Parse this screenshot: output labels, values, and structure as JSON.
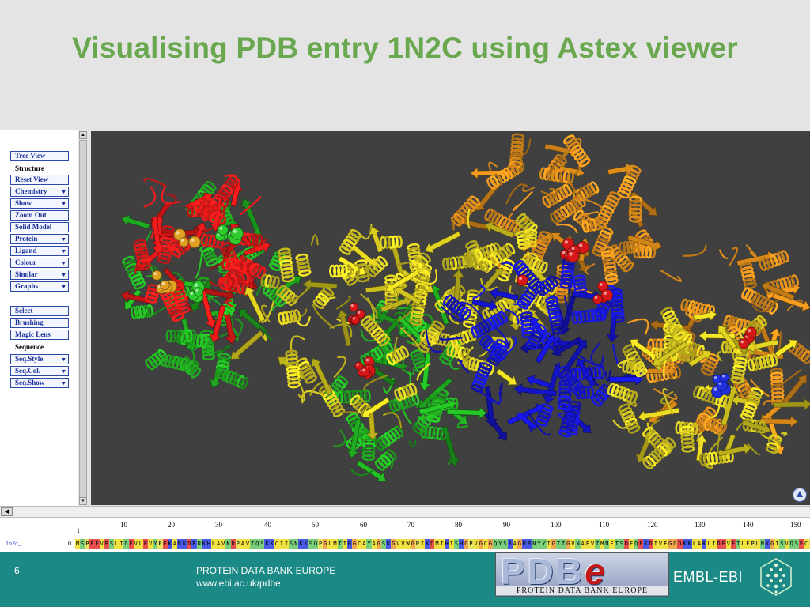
{
  "slide": {
    "title": "Visualising PDB entry 1N2C using Astex viewer"
  },
  "panel": {
    "items": [
      {
        "label": "Tree View",
        "type": "button",
        "dropdown": false
      },
      {
        "label": "Structure",
        "type": "label"
      },
      {
        "label": "Reset View",
        "type": "button",
        "dropdown": false
      },
      {
        "label": "Chemistry",
        "type": "button",
        "dropdown": true
      },
      {
        "label": "Show",
        "type": "button",
        "dropdown": true
      },
      {
        "label": "Zoom Out",
        "type": "button",
        "dropdown": false
      },
      {
        "label": "Solid Model",
        "type": "button",
        "dropdown": false
      },
      {
        "label": "Protein",
        "type": "button",
        "dropdown": true
      },
      {
        "label": "Ligand",
        "type": "button",
        "dropdown": true
      },
      {
        "label": "Colour",
        "type": "button",
        "dropdown": true
      },
      {
        "label": "Similar",
        "type": "button",
        "dropdown": true
      },
      {
        "label": "Graphs",
        "type": "button",
        "dropdown": true
      },
      {
        "label": "Select",
        "type": "button",
        "dropdown": false
      },
      {
        "label": "Brushing",
        "type": "button",
        "dropdown": false
      },
      {
        "label": "Magic Lens",
        "type": "button",
        "dropdown": false
      },
      {
        "label": "Sequence",
        "type": "label"
      },
      {
        "label": "Seq.Style",
        "type": "button",
        "dropdown": true
      },
      {
        "label": "Seq.Col.",
        "type": "button",
        "dropdown": true
      },
      {
        "label": "Seq.Show",
        "type": "button",
        "dropdown": true
      }
    ]
  },
  "viewer": {
    "background": "#404040",
    "chain_colors": [
      "#d81818",
      "#1fa81f",
      "#cdc01e",
      "#1414c8",
      "#d6881a"
    ],
    "ligand_colors": [
      "#2ecc2e",
      "#d81818",
      "#e0a020",
      "#2030e0"
    ]
  },
  "sequence": {
    "ruler": [
      "1",
      "10",
      "20",
      "30",
      "40",
      "50",
      "60",
      "70",
      "80",
      "90",
      "100",
      "110",
      "120",
      "130",
      "140",
      "150"
    ],
    "chain": "1n2c_",
    "start": "0",
    "residues": "MSPEEVESLIQEVLEVYPEKARKDRNKHLAVNDPAVTQSKKCIISNKKSQPGLMTIRGCAYAGSKGVVWGPIKDMIHISHGPVGCGQYSRAGRRNYYIGTTGVNAFVTMNFTSDFQEKDIVFGGDKKLAKLIDEVETLFPLNKGISVQSECPI"
  },
  "footer": {
    "page": "6",
    "org_line1": "PROTEIN DATA BANK EUROPE",
    "org_line2": "www.ebi.ac.uk/pdbe",
    "logo_text": "PDBe",
    "logo_sub": "PROTEIN DATA BANK EUROPE",
    "embl": "EMBL-EBI"
  }
}
